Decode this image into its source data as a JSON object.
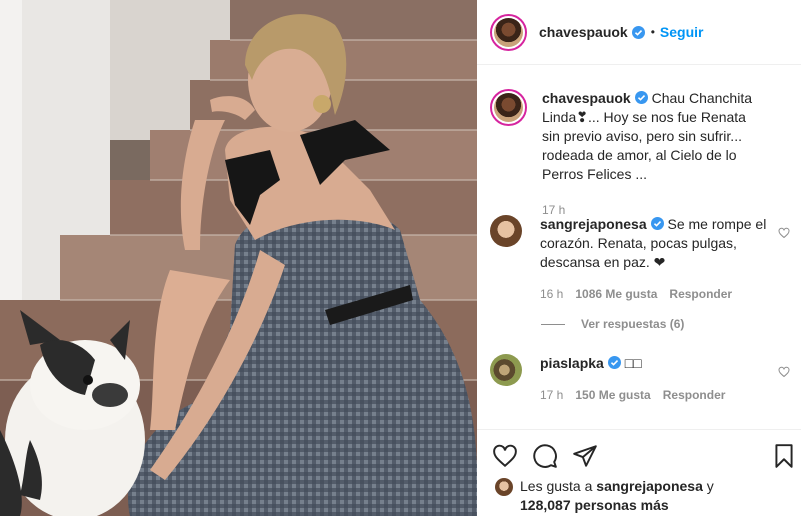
{
  "header": {
    "username": "chavespauok",
    "separator": "•",
    "follow_label": "Seguir"
  },
  "caption": {
    "username": "chavespauok",
    "text": "Chau Chanchita Linda❣... Hoy se nos fue Renata sin previo aviso, pero sin sufrir... rodeada de amor, al Cielo de lo Perros Felices ...",
    "time": "17 h"
  },
  "comments": [
    {
      "username": "sangrejaponesa",
      "text": "Se me rompe el corazón. Renata, pocas pulgas, descansa en paz. ❤",
      "time": "16 h",
      "likes": "1086 Me gusta",
      "reply_label": "Responder"
    },
    {
      "username": "piaslapka",
      "text": "□□",
      "time": "17 h",
      "likes": "150 Me gusta",
      "reply_label": "Responder"
    }
  ],
  "view_replies_label": "Ver respuestas (6)",
  "likes_summary": {
    "prefix": "Les gusta a",
    "user": "sangrejaponesa",
    "suffix1": "y",
    "count": "128,087",
    "suffix2": "personas más"
  },
  "colors": {
    "link_blue": "#0095f6",
    "verified_blue": "#3897f0",
    "secondary_text": "#8e8e8e",
    "ring": "#d6249f"
  }
}
